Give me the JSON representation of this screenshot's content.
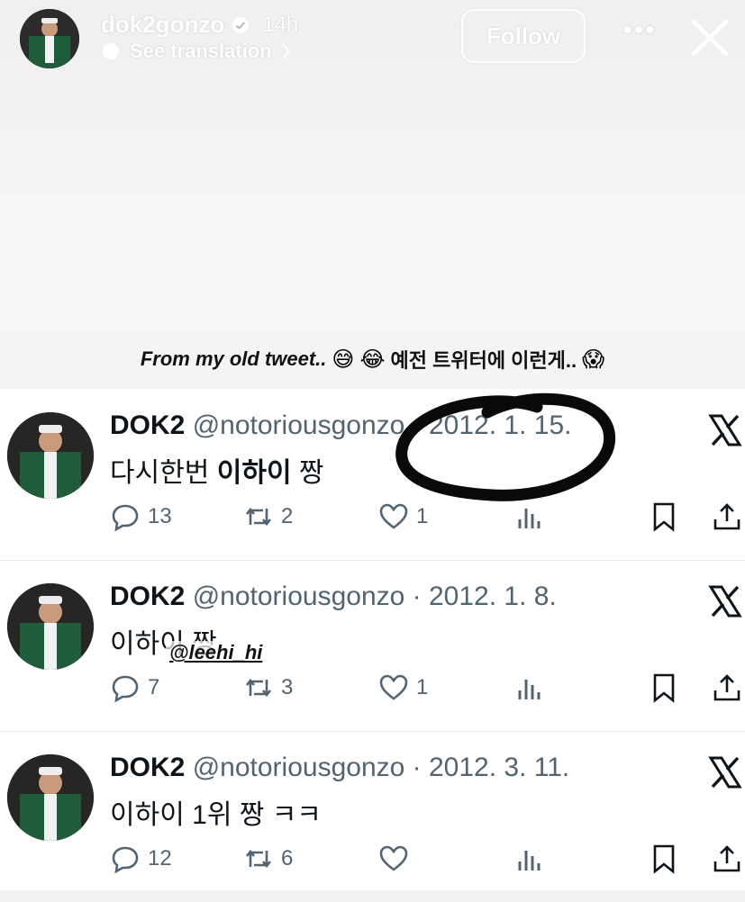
{
  "story": {
    "username": "dok2gonzo",
    "time": "14h",
    "see_translation": "See translation",
    "follow_label": "Follow",
    "more_label": "•••",
    "caption_en": "From my old tweet..",
    "caption_emojis": [
      "😅",
      "😂"
    ],
    "caption_ko": "예전 트위터에 이런게..",
    "caption_end_emoji": "😱",
    "mention_sticker": "@leehi_hi"
  },
  "tweets": [
    {
      "name": "DOK2",
      "handle": "@notoriousgonzo",
      "date": "2012. 1. 15.",
      "text_prefix": "다시한번 ",
      "text_bold": "이하이",
      "text_suffix": " 짱",
      "replies": "13",
      "retweets": "2",
      "likes": "1"
    },
    {
      "name": "DOK2",
      "handle": "@notoriousgonzo",
      "date": "2012. 1. 8.",
      "text_prefix": "",
      "text_bold": "이하이",
      "text_suffix": " 짱",
      "replies": "7",
      "retweets": "3",
      "likes": "1"
    },
    {
      "name": "DOK2",
      "handle": "@notoriousgonzo",
      "date": "2012. 3. 11.",
      "text_prefix": "",
      "text_bold": "이하이",
      "text_suffix": " 1위 짱 ㅋㅋ",
      "replies": "12",
      "retweets": "6",
      "likes": ""
    }
  ],
  "colors": {
    "text": "#0f1419",
    "muted": "#536471",
    "accent_story_text": "#ffffff"
  },
  "icons": [
    "verified-icon",
    "globe-icon",
    "chevron-right-icon",
    "close-icon",
    "x-logo-icon",
    "reply-icon",
    "retweet-icon",
    "like-icon",
    "views-icon",
    "bookmark-icon",
    "share-icon"
  ]
}
